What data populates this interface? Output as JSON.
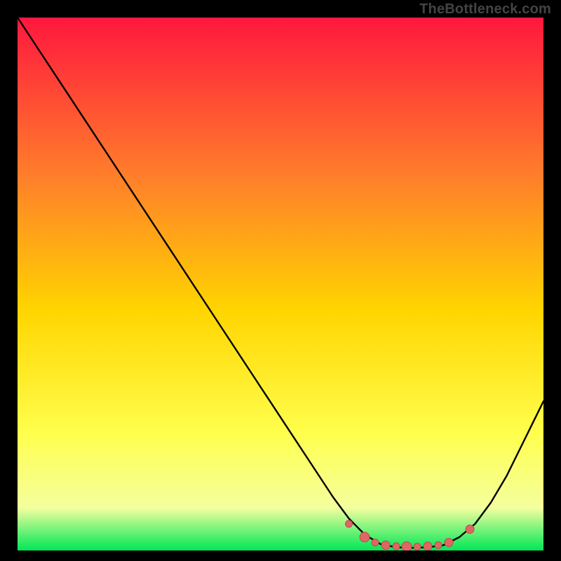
{
  "watermark": "TheBottleneck.com",
  "colors": {
    "bg": "#000000",
    "curve": "#000000",
    "marker_fill": "#e06666",
    "marker_stroke": "#be4b4b",
    "grad_top": "#ff173e",
    "grad_mid_upper": "#ff7f2a",
    "grad_mid": "#ffd500",
    "grad_mid_lower": "#ffff4d",
    "grad_lower": "#f4ff9e",
    "grad_bottom": "#00e756"
  },
  "chart_data": {
    "type": "line",
    "title": "",
    "xlabel": "",
    "ylabel": "",
    "xlim": [
      0,
      100
    ],
    "ylim": [
      0,
      100
    ],
    "series": [
      {
        "name": "bottleneck-curve",
        "x": [
          0,
          4,
          8,
          12,
          16,
          20,
          24,
          28,
          32,
          36,
          40,
          44,
          48,
          52,
          56,
          60,
          63,
          66,
          69,
          72,
          75,
          78,
          81,
          84,
          87,
          90,
          93,
          96,
          100
        ],
        "y": [
          100,
          94,
          88,
          82,
          76,
          70,
          64,
          58,
          52,
          46,
          40,
          34,
          28,
          22,
          16,
          10,
          6,
          3,
          1.2,
          0.6,
          0.5,
          0.6,
          1.0,
          2.5,
          5,
          9,
          14,
          20,
          28
        ]
      }
    ],
    "markers": {
      "name": "optimal-range",
      "points": [
        {
          "x": 63,
          "y": 5.0,
          "r": 5
        },
        {
          "x": 66,
          "y": 2.5,
          "r": 7
        },
        {
          "x": 68,
          "y": 1.5,
          "r": 5
        },
        {
          "x": 70,
          "y": 1.0,
          "r": 6
        },
        {
          "x": 72,
          "y": 0.8,
          "r": 5
        },
        {
          "x": 74,
          "y": 0.7,
          "r": 7
        },
        {
          "x": 76,
          "y": 0.7,
          "r": 5
        },
        {
          "x": 78,
          "y": 0.8,
          "r": 6
        },
        {
          "x": 80,
          "y": 1.0,
          "r": 5
        },
        {
          "x": 82,
          "y": 1.5,
          "r": 6
        },
        {
          "x": 86,
          "y": 4.0,
          "r": 6
        }
      ]
    },
    "gradient_stops": [
      {
        "offset": 0.0,
        "key": "grad_top"
      },
      {
        "offset": 0.3,
        "key": "grad_mid_upper"
      },
      {
        "offset": 0.55,
        "key": "grad_mid"
      },
      {
        "offset": 0.78,
        "key": "grad_mid_lower"
      },
      {
        "offset": 0.92,
        "key": "grad_lower"
      },
      {
        "offset": 1.0,
        "key": "grad_bottom"
      }
    ]
  }
}
